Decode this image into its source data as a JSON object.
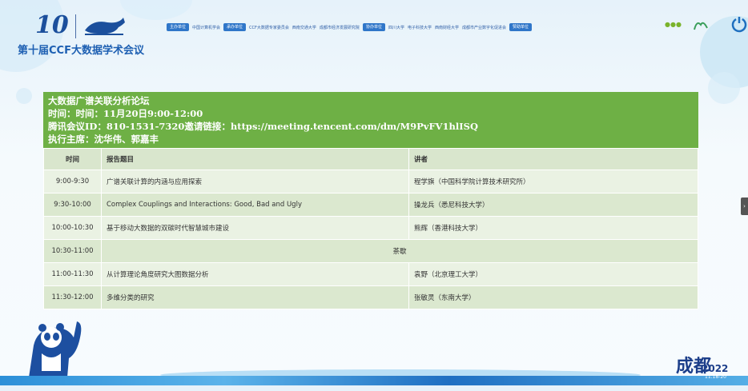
{
  "header": {
    "conference_title": "第十届CCF大数据学术会议",
    "logo_number": "10",
    "sponsors": [
      {
        "kind": "tag",
        "text": "主办单位"
      },
      {
        "kind": "text",
        "text": "中国计算机学会"
      },
      {
        "kind": "tag",
        "text": "承办单位"
      },
      {
        "kind": "text",
        "text": "CCF大数据专家委员会"
      },
      {
        "kind": "text",
        "text": "西南交通大学"
      },
      {
        "kind": "text",
        "text": "成都市经济发展研究院"
      },
      {
        "kind": "tag",
        "text": "协办单位"
      },
      {
        "kind": "text",
        "text": "四川大学"
      },
      {
        "kind": "text",
        "text": "电子科技大学"
      },
      {
        "kind": "text",
        "text": "西南财经大学"
      },
      {
        "kind": "text",
        "text": "成都市产业数字化促进会"
      },
      {
        "kind": "tag",
        "text": "赞助单位"
      }
    ]
  },
  "forum": {
    "name": "大数据广谱关联分析论坛",
    "time_line": "时间：时间：11月20日9:00-12:00",
    "meeting_line": "腾讯会议ID：810-1531-7320邀请链接：https://meeting.tencent.com/dm/M9PvFV1hlISQ",
    "chairs_line": "执行主席：沈华伟、郭嘉丰"
  },
  "schedule": {
    "headers": {
      "time": "时间",
      "topic": "报告题目",
      "speaker": "讲者"
    },
    "rows": [
      {
        "time": "9:00-9:30",
        "topic": "广谱关联计算的内涵与应用探索",
        "speaker": "程学旗（中国科学院计算技术研究所）"
      },
      {
        "time": "9:30-10:00",
        "topic": "Complex Couplings and Interactions: Good, Bad and Ugly",
        "speaker": "操龙兵（悉尼科技大学）"
      },
      {
        "time": "10:00-10:30",
        "topic": "基于移动大数据的双碳时代智慧城市建设",
        "speaker": "熊辉（香港科技大学）"
      },
      {
        "time": "10:30-11:00",
        "break": "茶歇"
      },
      {
        "time": "11:00-11:30",
        "topic": "从计算理论角度研究大图数据分析",
        "speaker": "袁野（北京理工大学）"
      },
      {
        "time": "11:30-12:00",
        "topic": "多维分类的研究",
        "speaker": "张敏灵（东南大学）"
      }
    ]
  },
  "footer": {
    "year": "2022",
    "date": "11.18-20",
    "calligraphy": "成都"
  },
  "colors": {
    "accent_green": "#6eb045",
    "brand_blue": "#1d5fb2",
    "row_light": "#eaf2e3",
    "row_dark": "#dbe8cf"
  },
  "icons": [
    "panda-mascot-icon",
    "power-icon",
    "whale-logo-icon",
    "side-handle-icon"
  ]
}
